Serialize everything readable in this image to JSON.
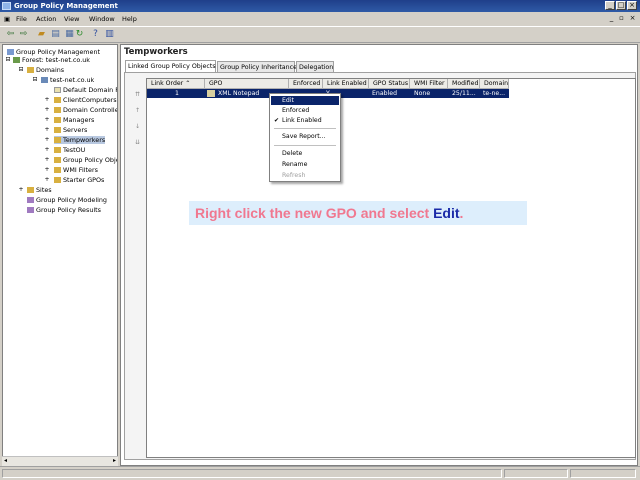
{
  "window": {
    "title": "Group Policy Management"
  },
  "menu": [
    "File",
    "Action",
    "View",
    "Window",
    "Help"
  ],
  "tree": {
    "root": "Group Policy Management",
    "forest": "Forest: test-net.co.uk",
    "domains": "Domains",
    "domain": "test-net.co.uk",
    "children": [
      "Default Domain P",
      "ClientComputers",
      "Domain Controlle",
      "Managers",
      "Servers",
      "Tempworkers",
      "TestOU",
      "Group Policy Obje",
      "WMI Filters",
      "Starter GPOs"
    ],
    "sites": "Sites",
    "modeling": "Group Policy Modeling",
    "results": "Group Policy Results"
  },
  "main": {
    "header": "Tempworkers",
    "tabs": [
      "Linked Group Policy Objects",
      "Group Policy Inheritance",
      "Delegation"
    ],
    "columns": [
      "Link Order",
      "GPO",
      "Enforced",
      "Link Enabled",
      "GPO Status",
      "WMI Filter",
      "Modified",
      "Domain"
    ],
    "row": {
      "link_order": "1",
      "gpo": "XML Notepad",
      "enforced": "",
      "link_enabled": "Y",
      "gpo_status": "Enabled",
      "wmi_filter": "None",
      "modified": "25/11...",
      "domain": "te-ne..."
    }
  },
  "context_menu": {
    "items": [
      "Edit",
      "Enforced",
      "Link Enabled",
      "Save Report...",
      "Delete",
      "Rename",
      "Refresh"
    ],
    "highlighted": "Edit",
    "checked": "Link Enabled"
  },
  "callout": {
    "text": "Right click the new GPO and select",
    "emphasis": "Edit",
    "suffix": "."
  },
  "colors": {
    "title_bar": "#2f5aa6",
    "selection": "#0a246a",
    "callout_bg": "#ddeefc",
    "callout_text": "#f07890",
    "callout_emphasis": "#1a2aa8"
  }
}
